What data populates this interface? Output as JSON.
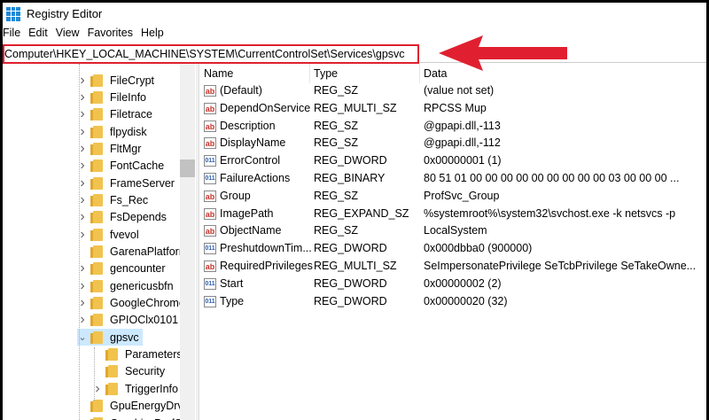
{
  "window": {
    "title": "Registry Editor"
  },
  "menu": [
    "File",
    "Edit",
    "View",
    "Favorites",
    "Help"
  ],
  "address": "Computer\\HKEY_LOCAL_MACHINE\\SYSTEM\\CurrentControlSet\\Services\\gpsvc",
  "annotation_color": "#e02030",
  "tree": [
    {
      "label": "FileCrypt",
      "level": 0,
      "expander": "collapsed"
    },
    {
      "label": "FileInfo",
      "level": 0,
      "expander": "collapsed"
    },
    {
      "label": "Filetrace",
      "level": 0,
      "expander": "collapsed"
    },
    {
      "label": "flpydisk",
      "level": 0,
      "expander": "collapsed"
    },
    {
      "label": "FltMgr",
      "level": 0,
      "expander": "collapsed"
    },
    {
      "label": "FontCache",
      "level": 0,
      "expander": "collapsed"
    },
    {
      "label": "FrameServer",
      "level": 0,
      "expander": "collapsed"
    },
    {
      "label": "Fs_Rec",
      "level": 0,
      "expander": "collapsed"
    },
    {
      "label": "FsDepends",
      "level": 0,
      "expander": "collapsed"
    },
    {
      "label": "fvevol",
      "level": 0,
      "expander": "collapsed"
    },
    {
      "label": "GarenaPlatform",
      "level": 0,
      "expander": "none"
    },
    {
      "label": "gencounter",
      "level": 0,
      "expander": "collapsed"
    },
    {
      "label": "genericusbfn",
      "level": 0,
      "expander": "collapsed"
    },
    {
      "label": "GoogleChrome",
      "level": 0,
      "expander": "collapsed"
    },
    {
      "label": "GPIOClx0101",
      "level": 0,
      "expander": "collapsed"
    },
    {
      "label": "gpsvc",
      "level": 0,
      "expander": "expanded",
      "selected": true
    },
    {
      "label": "Parameters",
      "level": 1,
      "expander": "none"
    },
    {
      "label": "Security",
      "level": 1,
      "expander": "none"
    },
    {
      "label": "TriggerInfo",
      "level": 1,
      "expander": "collapsed"
    },
    {
      "label": "GpuEnergyDrv",
      "level": 0,
      "expander": "none"
    },
    {
      "label": "GraphicsPerfSv",
      "level": 0,
      "expander": "collapsed"
    }
  ],
  "columns": [
    "Name",
    "Type",
    "Data"
  ],
  "values": [
    {
      "name": "(Default)",
      "type": "REG_SZ",
      "data": "(value not set)",
      "icon": "string"
    },
    {
      "name": "DependOnService",
      "type": "REG_MULTI_SZ",
      "data": "RPCSS Mup",
      "icon": "string"
    },
    {
      "name": "Description",
      "type": "REG_SZ",
      "data": "@gpapi.dll,-113",
      "icon": "string"
    },
    {
      "name": "DisplayName",
      "type": "REG_SZ",
      "data": "@gpapi.dll,-112",
      "icon": "string"
    },
    {
      "name": "ErrorControl",
      "type": "REG_DWORD",
      "data": "0x00000001 (1)",
      "icon": "binary"
    },
    {
      "name": "FailureActions",
      "type": "REG_BINARY",
      "data": "80 51 01 00 00 00 00 00 00 00 00 00 03 00 00 00 ...",
      "icon": "binary"
    },
    {
      "name": "Group",
      "type": "REG_SZ",
      "data": "ProfSvc_Group",
      "icon": "string"
    },
    {
      "name": "ImagePath",
      "type": "REG_EXPAND_SZ",
      "data": "%systemroot%\\system32\\svchost.exe -k netsvcs -p",
      "icon": "string"
    },
    {
      "name": "ObjectName",
      "type": "REG_SZ",
      "data": "LocalSystem",
      "icon": "string"
    },
    {
      "name": "PreshutdownTim...",
      "type": "REG_DWORD",
      "data": "0x000dbba0 (900000)",
      "icon": "binary"
    },
    {
      "name": "RequiredPrivileges",
      "type": "REG_MULTI_SZ",
      "data": "SeImpersonatePrivilege SeTcbPrivilege SeTakeOwne...",
      "icon": "string"
    },
    {
      "name": "Start",
      "type": "REG_DWORD",
      "data": "0x00000002 (2)",
      "icon": "binary"
    },
    {
      "name": "Type",
      "type": "REG_DWORD",
      "data": "0x00000020 (32)",
      "icon": "binary"
    }
  ]
}
